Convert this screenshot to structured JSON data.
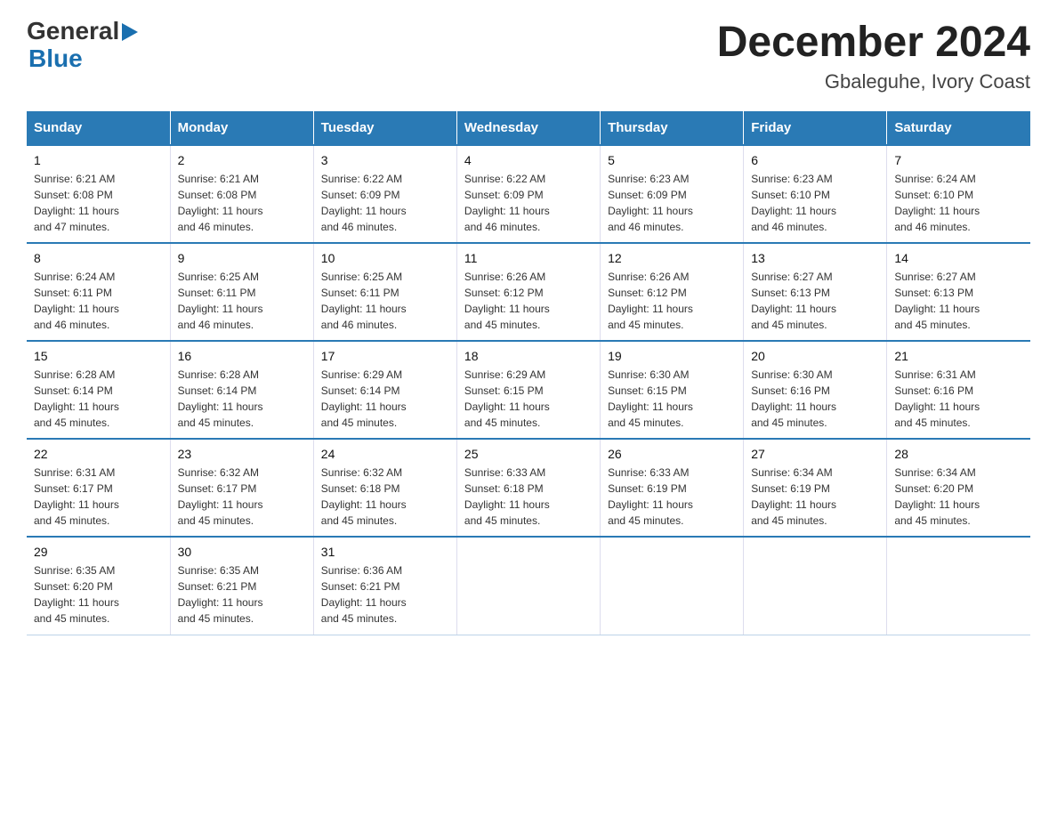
{
  "logo": {
    "general": "General",
    "blue": "Blue"
  },
  "title": "December 2024",
  "subtitle": "Gbaleguhe, Ivory Coast",
  "headers": [
    "Sunday",
    "Monday",
    "Tuesday",
    "Wednesday",
    "Thursday",
    "Friday",
    "Saturday"
  ],
  "weeks": [
    [
      {
        "day": "1",
        "sunrise": "6:21 AM",
        "sunset": "6:08 PM",
        "daylight": "11 hours and 47 minutes."
      },
      {
        "day": "2",
        "sunrise": "6:21 AM",
        "sunset": "6:08 PM",
        "daylight": "11 hours and 46 minutes."
      },
      {
        "day": "3",
        "sunrise": "6:22 AM",
        "sunset": "6:09 PM",
        "daylight": "11 hours and 46 minutes."
      },
      {
        "day": "4",
        "sunrise": "6:22 AM",
        "sunset": "6:09 PM",
        "daylight": "11 hours and 46 minutes."
      },
      {
        "day": "5",
        "sunrise": "6:23 AM",
        "sunset": "6:09 PM",
        "daylight": "11 hours and 46 minutes."
      },
      {
        "day": "6",
        "sunrise": "6:23 AM",
        "sunset": "6:10 PM",
        "daylight": "11 hours and 46 minutes."
      },
      {
        "day": "7",
        "sunrise": "6:24 AM",
        "sunset": "6:10 PM",
        "daylight": "11 hours and 46 minutes."
      }
    ],
    [
      {
        "day": "8",
        "sunrise": "6:24 AM",
        "sunset": "6:11 PM",
        "daylight": "11 hours and 46 minutes."
      },
      {
        "day": "9",
        "sunrise": "6:25 AM",
        "sunset": "6:11 PM",
        "daylight": "11 hours and 46 minutes."
      },
      {
        "day": "10",
        "sunrise": "6:25 AM",
        "sunset": "6:11 PM",
        "daylight": "11 hours and 46 minutes."
      },
      {
        "day": "11",
        "sunrise": "6:26 AM",
        "sunset": "6:12 PM",
        "daylight": "11 hours and 45 minutes."
      },
      {
        "day": "12",
        "sunrise": "6:26 AM",
        "sunset": "6:12 PM",
        "daylight": "11 hours and 45 minutes."
      },
      {
        "day": "13",
        "sunrise": "6:27 AM",
        "sunset": "6:13 PM",
        "daylight": "11 hours and 45 minutes."
      },
      {
        "day": "14",
        "sunrise": "6:27 AM",
        "sunset": "6:13 PM",
        "daylight": "11 hours and 45 minutes."
      }
    ],
    [
      {
        "day": "15",
        "sunrise": "6:28 AM",
        "sunset": "6:14 PM",
        "daylight": "11 hours and 45 minutes."
      },
      {
        "day": "16",
        "sunrise": "6:28 AM",
        "sunset": "6:14 PM",
        "daylight": "11 hours and 45 minutes."
      },
      {
        "day": "17",
        "sunrise": "6:29 AM",
        "sunset": "6:14 PM",
        "daylight": "11 hours and 45 minutes."
      },
      {
        "day": "18",
        "sunrise": "6:29 AM",
        "sunset": "6:15 PM",
        "daylight": "11 hours and 45 minutes."
      },
      {
        "day": "19",
        "sunrise": "6:30 AM",
        "sunset": "6:15 PM",
        "daylight": "11 hours and 45 minutes."
      },
      {
        "day": "20",
        "sunrise": "6:30 AM",
        "sunset": "6:16 PM",
        "daylight": "11 hours and 45 minutes."
      },
      {
        "day": "21",
        "sunrise": "6:31 AM",
        "sunset": "6:16 PM",
        "daylight": "11 hours and 45 minutes."
      }
    ],
    [
      {
        "day": "22",
        "sunrise": "6:31 AM",
        "sunset": "6:17 PM",
        "daylight": "11 hours and 45 minutes."
      },
      {
        "day": "23",
        "sunrise": "6:32 AM",
        "sunset": "6:17 PM",
        "daylight": "11 hours and 45 minutes."
      },
      {
        "day": "24",
        "sunrise": "6:32 AM",
        "sunset": "6:18 PM",
        "daylight": "11 hours and 45 minutes."
      },
      {
        "day": "25",
        "sunrise": "6:33 AM",
        "sunset": "6:18 PM",
        "daylight": "11 hours and 45 minutes."
      },
      {
        "day": "26",
        "sunrise": "6:33 AM",
        "sunset": "6:19 PM",
        "daylight": "11 hours and 45 minutes."
      },
      {
        "day": "27",
        "sunrise": "6:34 AM",
        "sunset": "6:19 PM",
        "daylight": "11 hours and 45 minutes."
      },
      {
        "day": "28",
        "sunrise": "6:34 AM",
        "sunset": "6:20 PM",
        "daylight": "11 hours and 45 minutes."
      }
    ],
    [
      {
        "day": "29",
        "sunrise": "6:35 AM",
        "sunset": "6:20 PM",
        "daylight": "11 hours and 45 minutes."
      },
      {
        "day": "30",
        "sunrise": "6:35 AM",
        "sunset": "6:21 PM",
        "daylight": "11 hours and 45 minutes."
      },
      {
        "day": "31",
        "sunrise": "6:36 AM",
        "sunset": "6:21 PM",
        "daylight": "11 hours and 45 minutes."
      },
      null,
      null,
      null,
      null
    ]
  ]
}
